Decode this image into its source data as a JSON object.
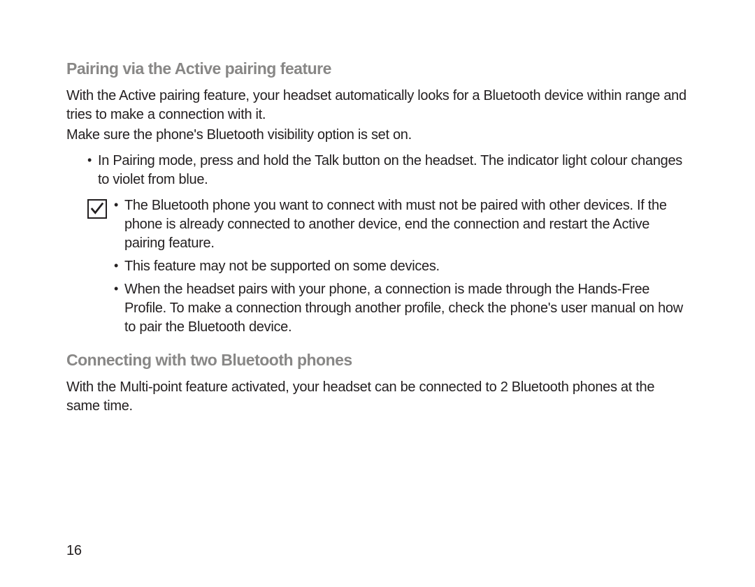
{
  "section1": {
    "heading": "Pairing via the Active pairing feature",
    "p1": "With the Active pairing feature, your headset automatically looks for a Bluetooth device within range and tries to make a connection with it.",
    "p2": "Make sure the phone's Bluetooth visibility option is set on.",
    "bullet1": "In Pairing mode, press and hold the Talk button on the headset. The indicator light colour changes to violet from blue.",
    "note": {
      "item1": "The Bluetooth phone you want to connect with must not be paired with other devices. If the phone is already connected to another device, end the connection and restart the Active pairing feature.",
      "item2": "This feature may not be supported on some devices.",
      "item3": "When the headset pairs with your phone, a connection is made through the Hands-Free Profile. To make a connection through another profile, check the phone's user manual on how to pair the Bluetooth device."
    }
  },
  "section2": {
    "heading": "Connecting with two Bluetooth phones",
    "p1": "With the Multi-point feature activated, your headset can be connected to 2 Bluetooth phones at the same time."
  },
  "pageNumber": "16"
}
